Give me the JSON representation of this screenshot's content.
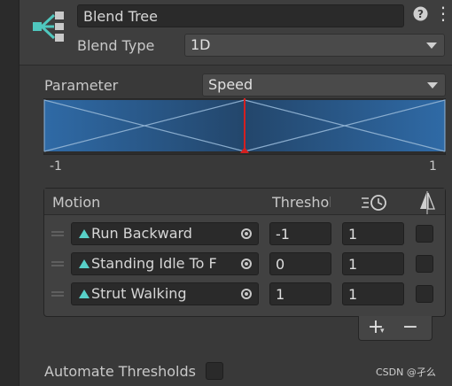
{
  "header": {
    "name_value": "Blend Tree",
    "blend_type_label": "Blend Type",
    "blend_type_value": "1D",
    "help_symbol": "?",
    "menu_symbol": "⋮",
    "node_icon": "blend-tree-node-icon"
  },
  "parameter": {
    "label": "Parameter",
    "value": "Speed"
  },
  "graph": {
    "min_label": "-1",
    "max_label": "1",
    "min": -1,
    "max": 1,
    "current_value": 0,
    "thresholds": [
      -1,
      0,
      1
    ],
    "colors": {
      "fill_dark": "#23466b",
      "fill_light": "#2f6aa6",
      "lines": "#8fb2d2",
      "marker": "#d42020"
    }
  },
  "motions": {
    "headers": {
      "motion": "Motion",
      "threshold": "Threshold",
      "speed_icon": "time-scale-icon",
      "mirror_icon": "mirror-icon"
    },
    "rows": [
      {
        "name": "Run Backward",
        "threshold": "-1",
        "speed": "1"
      },
      {
        "name": "Standing Idle To F",
        "threshold": "0",
        "speed": "1"
      },
      {
        "name": "Strut Walking",
        "threshold": "1",
        "speed": "1"
      }
    ],
    "add_symbol": "+",
    "add_dropdown_symbol": "▾",
    "remove_symbol": "−"
  },
  "automate": {
    "label": "Automate Thresholds"
  },
  "watermark": "CSDN @孑么"
}
